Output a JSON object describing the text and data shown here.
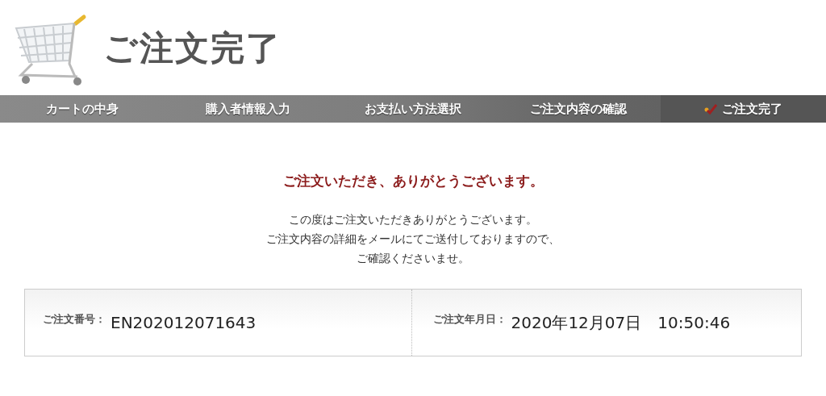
{
  "header": {
    "title": "ご注文完了"
  },
  "steps": [
    {
      "label": "カートの中身",
      "selected": false
    },
    {
      "label": "購入者情報入力",
      "selected": false
    },
    {
      "label": "お支払い方法選択",
      "selected": false
    },
    {
      "label": "ご注文内容の確認",
      "selected": false
    },
    {
      "label": "ご注文完了",
      "selected": true
    }
  ],
  "thanks": {
    "heading": "ご注文いただき、ありがとうございます。",
    "lines": [
      "この度はご注文いただきありがとうございます。",
      "ご注文内容の詳細をメールにてご送付しておりますので、",
      "ご確認くださいませ。"
    ]
  },
  "order": [
    {
      "label": "ご注文番号：",
      "value": "EN202012071643"
    },
    {
      "label": "ご注文年月日：",
      "value": "2020年12月07日　10:50:46"
    }
  ]
}
